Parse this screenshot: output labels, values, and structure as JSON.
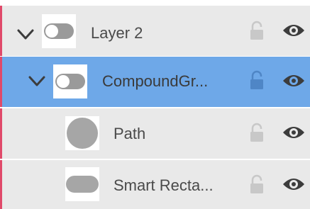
{
  "colors": {
    "row_bg": "#e9e9e9",
    "selected_row_bg": "#6ea8e8",
    "layer_color_bar": "#e04a6a",
    "text": "#4a4a4a",
    "icon_dark": "#3c3c3c",
    "icon_light": "#c8c8c8"
  },
  "layers": [
    {
      "name": "Layer 2",
      "expanded": true,
      "thumbnail": "toggle-shape-icon",
      "locked": false,
      "visible": true,
      "selected": false
    },
    {
      "name": "CompoundGr...",
      "expanded": true,
      "thumbnail": "toggle-shape-icon",
      "locked": false,
      "visible": true,
      "selected": true
    },
    {
      "name": "Path",
      "thumbnail": "circle-shape-icon",
      "locked": false,
      "visible": true,
      "selected": false
    },
    {
      "name": "Smart Recta...",
      "thumbnail": "rounded-rect-shape-icon",
      "locked": false,
      "visible": true,
      "selected": false
    }
  ]
}
